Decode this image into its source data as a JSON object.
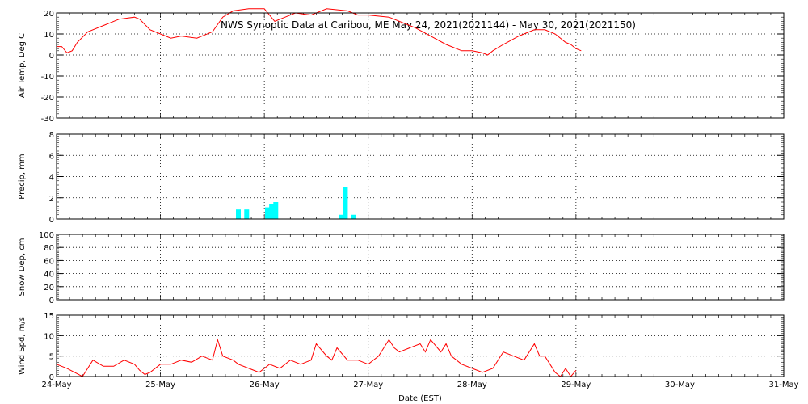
{
  "title": "NWS Synoptic Data at Caribou, ME   May 24, 2021(2021144) - May 30, 2021(2021150)",
  "xlabel": "Date (EST)",
  "x_ticks": [
    "24-May",
    "25-May",
    "26-May",
    "27-May",
    "28-May",
    "29-May",
    "30-May",
    "31-May"
  ],
  "colors": {
    "line": "#ff0000",
    "bar": "#00ffff",
    "axis": "#000000"
  },
  "chart_data": [
    {
      "type": "line",
      "ylabel": "Air Temp, Deg C",
      "ylim": [
        -30,
        20
      ],
      "yticks": [
        "-30",
        "-20",
        "-10",
        "0",
        "10",
        "20"
      ],
      "grid": true,
      "x_unit": "days since 24-May 00:00",
      "x": [
        0.0,
        0.05,
        0.1,
        0.15,
        0.2,
        0.3,
        0.45,
        0.6,
        0.75,
        0.8,
        0.9,
        1.0,
        1.1,
        1.2,
        1.35,
        1.5,
        1.6,
        1.7,
        1.85,
        2.0,
        2.1,
        2.2,
        2.3,
        2.45,
        2.6,
        2.8,
        2.9,
        3.0,
        3.2,
        3.45,
        3.6,
        3.75,
        3.9,
        4.0,
        4.1,
        4.15,
        4.2,
        4.3,
        4.45,
        4.6,
        4.7,
        4.8,
        4.9,
        4.95,
        5.0,
        5.05
      ],
      "values": [
        4,
        4,
        1,
        2,
        6,
        11,
        14,
        17,
        18,
        17,
        12,
        10,
        8,
        9,
        8,
        11,
        18,
        21,
        22,
        22,
        16,
        18,
        20,
        19,
        22,
        21,
        19,
        19,
        18,
        13,
        9,
        5,
        2,
        2,
        1,
        0,
        2,
        5,
        9,
        12,
        12,
        10,
        6,
        5,
        3,
        2
      ]
    },
    {
      "type": "bar",
      "ylabel": "Precip, mm",
      "ylim": [
        0,
        8
      ],
      "yticks": [
        "0",
        "2",
        "4",
        "6",
        "8"
      ],
      "grid": true,
      "x_unit": "days since 24-May 00:00",
      "x": [
        1.75,
        1.83,
        2.03,
        2.07,
        2.11,
        2.74,
        2.78,
        2.86
      ],
      "values": [
        0.9,
        0.9,
        1.1,
        1.4,
        1.6,
        0.4,
        3.0,
        0.4
      ]
    },
    {
      "type": "line",
      "ylabel": "Snow Dep, cm",
      "ylim": [
        0,
        100
      ],
      "yticks": [
        "0",
        "20",
        "40",
        "60",
        "80",
        "100"
      ],
      "grid": true,
      "x": [],
      "values": []
    },
    {
      "type": "line",
      "ylabel": "Wind Spd, m/s",
      "ylim": [
        0,
        15
      ],
      "yticks": [
        "0",
        "5",
        "10",
        "15"
      ],
      "grid": true,
      "x_unit": "days since 24-May 00:00",
      "x": [
        0.0,
        0.1,
        0.25,
        0.35,
        0.45,
        0.55,
        0.65,
        0.75,
        0.8,
        0.85,
        0.9,
        1.0,
        1.1,
        1.2,
        1.3,
        1.4,
        1.5,
        1.55,
        1.6,
        1.7,
        1.75,
        1.85,
        1.95,
        2.05,
        2.15,
        2.25,
        2.35,
        2.45,
        2.5,
        2.6,
        2.65,
        2.7,
        2.8,
        2.9,
        3.0,
        3.1,
        3.2,
        3.25,
        3.3,
        3.4,
        3.5,
        3.55,
        3.6,
        3.7,
        3.75,
        3.8,
        3.9,
        4.0,
        4.1,
        4.2,
        4.3,
        4.4,
        4.5,
        4.6,
        4.65,
        4.7,
        4.75,
        4.8,
        4.85,
        4.9,
        4.95,
        5.0
      ],
      "values": [
        3,
        2,
        0,
        4,
        2.5,
        2.5,
        4,
        3,
        1.5,
        0.5,
        1,
        3,
        3,
        4,
        3.5,
        5,
        4,
        9,
        5,
        4,
        3,
        2,
        1,
        3,
        2,
        4,
        3,
        4,
        8,
        5,
        4,
        7,
        4,
        4,
        3,
        5,
        9,
        7,
        6,
        7,
        8,
        6,
        9,
        6,
        8,
        5,
        3,
        2,
        1,
        2,
        6,
        5,
        4,
        8,
        5,
        5,
        3,
        1,
        0,
        2,
        0,
        1.5
      ]
    }
  ]
}
